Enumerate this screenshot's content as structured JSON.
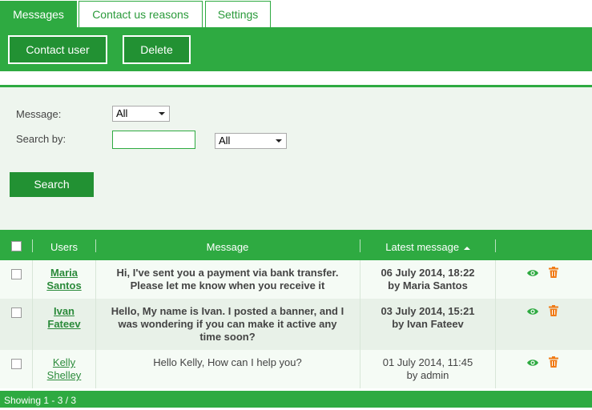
{
  "tabs": [
    {
      "label": "Messages",
      "active": true
    },
    {
      "label": "Contact us reasons",
      "active": false
    },
    {
      "label": "Settings",
      "active": false
    }
  ],
  "toolbar": {
    "contact_label": "Contact user",
    "delete_label": "Delete"
  },
  "filter": {
    "message_label": "Message:",
    "message_select": "All",
    "search_by_label": "Search by:",
    "search_value": "",
    "search_by_select": "All",
    "search_button": "Search"
  },
  "table": {
    "columns": {
      "users": "Users",
      "message": "Message",
      "latest": "Latest message"
    },
    "sort_indicator": "ascending",
    "rows": [
      {
        "user_first": "Maria",
        "user_last": "Santos",
        "message_line1": "Hi, I've sent you a payment via bank transfer.",
        "message_line2": "Please let me know when you receive it",
        "message_line3": "",
        "date": "06 July 2014, 18:22",
        "by": "by Maria Santos",
        "unread": true
      },
      {
        "user_first": "Ivan",
        "user_last": "Fateev",
        "message_line1": "Hello, My name is Ivan. I posted a banner, and I",
        "message_line2": "was wondering if you can make it active any",
        "message_line3": "time soon?",
        "date": "03 July 2014, 15:21",
        "by": "by Ivan Fateev",
        "unread": true
      },
      {
        "user_first": "Kelly",
        "user_last": "Shelley",
        "message_line1": "Hello Kelly, How can I help you?",
        "message_line2": "",
        "message_line3": "",
        "date": "01 July 2014, 11:45",
        "by": "by admin",
        "unread": false
      }
    ]
  },
  "footer": {
    "showing": "Showing 1 - 3 / 3"
  },
  "colors": {
    "brand_green": "#2eaa41",
    "dark_green": "#229133",
    "eye_icon": "#2eaa41",
    "trash_icon": "#f07b16"
  },
  "icons": {
    "view": "eye-icon",
    "delete": "trash-icon"
  }
}
